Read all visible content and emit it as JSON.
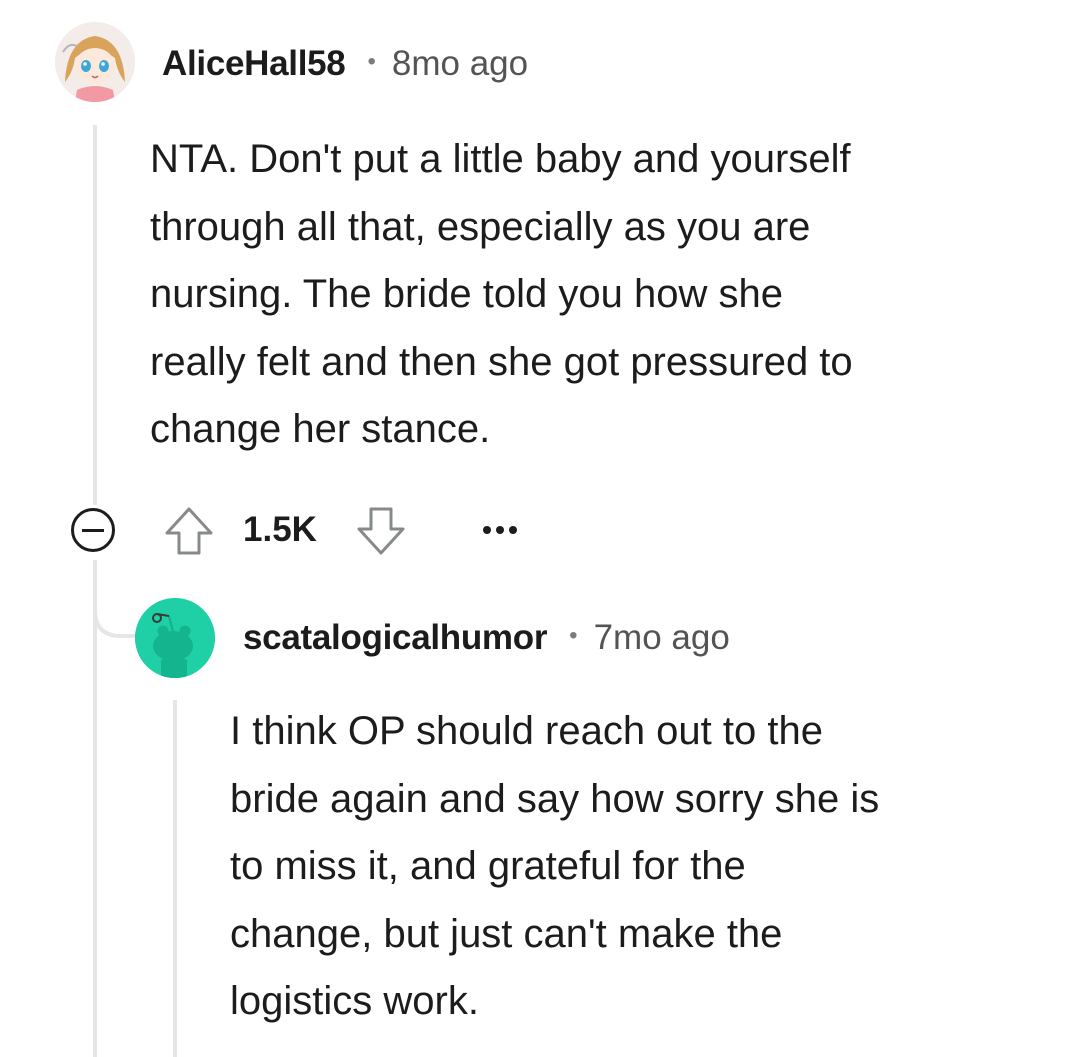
{
  "comments": [
    {
      "username": "AliceHall58",
      "separator": "•",
      "time": "8mo ago",
      "body": "NTA. Don't put a little baby and yourself\nthrough all that, especially as you are\nnursing. The bride told you how she\nreally felt and then she got pressured to\nchange her stance.",
      "score": "1.5K",
      "avatar_icon": "anime-girl-avatar-icon"
    },
    {
      "username": "scatalogicalhumor",
      "separator": "•",
      "time": "7mo ago",
      "body": "I think OP should reach out to the\nbride again and say how sorry she is\nto miss it, and grateful for the\nchange, but just can't make the\nlogistics work.",
      "avatar_icon": "snoo-avatar-icon"
    }
  ],
  "colors": {
    "reply_avatar_bg": "#1fd0a6",
    "thread_line": "#e6e6e6",
    "meta_text": "#545454"
  }
}
